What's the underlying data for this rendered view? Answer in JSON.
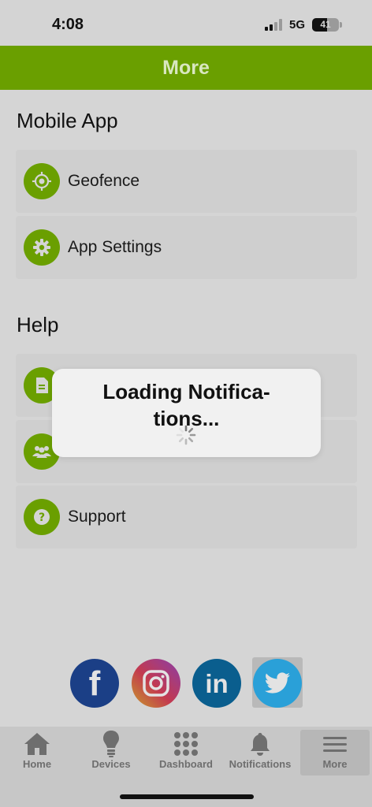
{
  "status_bar": {
    "time": "4:08",
    "network": "5G",
    "battery": "41"
  },
  "header": {
    "title": "More"
  },
  "sections": {
    "mobile_app": {
      "title": "Mobile App",
      "items": [
        {
          "label": "Geofence",
          "icon": "crosshair-icon"
        },
        {
          "label": "App Settings",
          "icon": "gear-icon"
        }
      ]
    },
    "help": {
      "title": "Help",
      "items": [
        {
          "label": "",
          "icon": "document-icon"
        },
        {
          "label": "",
          "icon": "people-icon"
        },
        {
          "label": "Support",
          "icon": "question-icon"
        }
      ]
    }
  },
  "loading": {
    "text": "Loading Notifica-tions..."
  },
  "social": [
    {
      "name": "facebook",
      "color": "#1b3f86",
      "glyph": "f"
    },
    {
      "name": "instagram",
      "color": "#c2326f"
    },
    {
      "name": "linkedin",
      "color": "#0a5e8e",
      "glyph": "in"
    },
    {
      "name": "twitter",
      "color": "#2aa0d8"
    }
  ],
  "tabs": [
    {
      "label": "Home",
      "icon": "home-icon"
    },
    {
      "label": "Devices",
      "icon": "lightbulb-icon"
    },
    {
      "label": "Dashboard",
      "icon": "grid-icon"
    },
    {
      "label": "Notifications",
      "icon": "bell-icon"
    },
    {
      "label": "More",
      "icon": "menu-icon",
      "active": true
    }
  ],
  "colors": {
    "brand_green": "#6a9f00",
    "header_text": "#d9e7c0"
  }
}
